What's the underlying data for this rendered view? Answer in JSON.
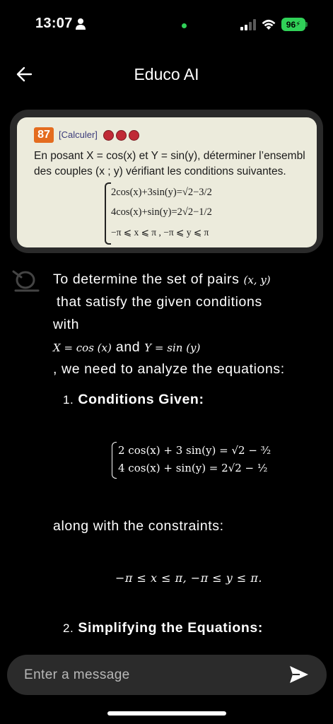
{
  "status_bar": {
    "time": "13:07",
    "battery": "96"
  },
  "header": {
    "title": "Educo AI"
  },
  "exercise_image": {
    "number": "87",
    "tag": "[Calculer]",
    "line1": "En posant X = cos(x) et Y = sin(y), déterminer l’ensembl",
    "line2": "des couples (x ; y) vérifiant les conditions suivantes.",
    "eq1": "2cos(x)+3sin(y)=√2−3/2",
    "eq2": "4cos(x)+sin(y)=2√2−1/2",
    "eq3": "−π ⩽ x ⩽ π , −π ⩽ y ⩽ π"
  },
  "response": {
    "line1": "To determine the set of pairs",
    "pair": "(x, y)",
    "line2": "that satisfy the given conditions",
    "line3": "with",
    "defs_x": "X = cos (x)",
    "defs_and": "and",
    "defs_y": "Y = sin (y)",
    "line4": ", we need to analyze the equations:",
    "section1_num": "1.",
    "section1_title": "Conditions Given:",
    "sys_eq1": "2 cos(x) + 3 sin(y) = √2 − ³⁄₂",
    "sys_eq2": "4 cos(x) + sin(y) = 2√2 − ¹⁄₂",
    "along": "along with the constraints:",
    "constraints": "−π ≤ x ≤ π,   −π ≤ y ≤ π.",
    "section2_num": "2.",
    "section2_title": "Simplifying the Equations:"
  },
  "input": {
    "placeholder": "Enter a message"
  }
}
